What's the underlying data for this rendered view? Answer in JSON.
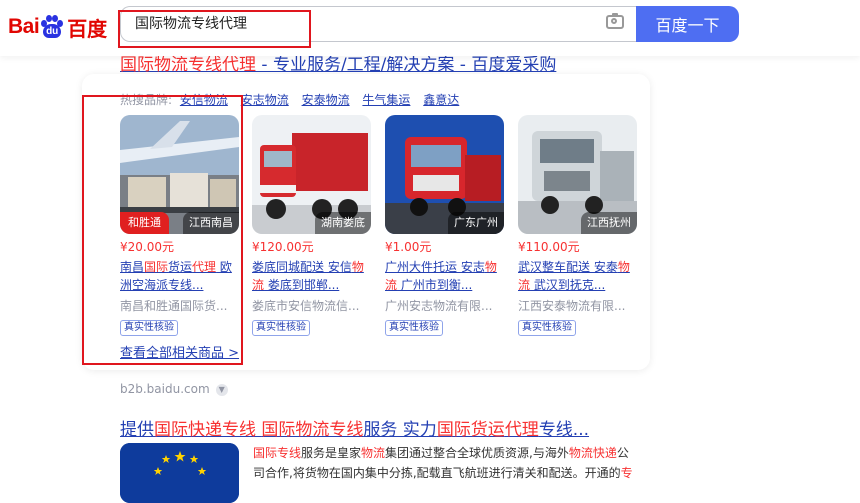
{
  "logo": {
    "part1": "Bai",
    "paw": "du",
    "cn": "百度"
  },
  "search": {
    "value": "国际物流专线代理",
    "button": "百度一下"
  },
  "result1": {
    "title_parts": [
      {
        "t": "国际物流专线代理",
        "em": true
      },
      {
        "t": " - 专业服务/工程/解决方案 - 百度爱采购",
        "em": false
      }
    ]
  },
  "hot_brands": {
    "label": "热搜品牌:",
    "items": [
      "安信物流",
      "安志物流",
      "安泰物流",
      "牛气集运",
      "鑫意达"
    ]
  },
  "products": [
    {
      "location": "江西南昌",
      "tag": "和胜通",
      "price": "¥20.00元",
      "title_parts": [
        {
          "t": "南昌",
          "em": false
        },
        {
          "t": "国际",
          "em": true
        },
        {
          "t": "货运",
          "em": false
        },
        {
          "t": "代理",
          "em": true
        },
        {
          "t": " 欧洲空海派专线...",
          "em": false
        }
      ],
      "seller": "南昌和胜通国际货...",
      "verify": "真实性核验"
    },
    {
      "location": "湖南娄底",
      "tag": "",
      "price": "¥120.00元",
      "title_parts": [
        {
          "t": "娄底同城配送 安信",
          "em": false
        },
        {
          "t": "物流",
          "em": true
        },
        {
          "t": " 娄底到邯郸...",
          "em": false
        }
      ],
      "seller": "娄底市安信物流信...",
      "verify": "真实性核验"
    },
    {
      "location": "广东广州",
      "tag": "",
      "price": "¥1.00元",
      "title_parts": [
        {
          "t": "广州大件托运 安志",
          "em": false
        },
        {
          "t": "物流",
          "em": true
        },
        {
          "t": " 广州市到衡...",
          "em": false
        }
      ],
      "seller": "广州安志物流有限...",
      "verify": "真实性核验"
    },
    {
      "location": "江西抚州",
      "tag": "",
      "price": "¥110.00元",
      "title_parts": [
        {
          "t": "武汉整车配送 安泰",
          "em": false
        },
        {
          "t": "物流",
          "em": true
        },
        {
          "t": " 武汉到抚克...",
          "em": false
        }
      ],
      "seller": "江西安泰物流有限...",
      "verify": "真实性核验"
    }
  ],
  "view_all": "查看全部相关商品 >",
  "source": "b2b.baidu.com",
  "result2": {
    "title_parts": [
      {
        "t": "提供",
        "em": false
      },
      {
        "t": "国际快递专线",
        "em": true
      },
      {
        "t": " ",
        "em": false
      },
      {
        "t": "国际物流专线",
        "em": true
      },
      {
        "t": "服务 实力",
        "em": false
      },
      {
        "t": "国际货运",
        "em": true
      },
      {
        "t": "代理",
        "em": true
      },
      {
        "t": "专线...",
        "em": false
      }
    ],
    "snippet_parts": [
      {
        "t": "国际专线",
        "em": true
      },
      {
        "t": "服务是皇家",
        "em": false
      },
      {
        "t": "物流",
        "em": true
      },
      {
        "t": "集团通过整合全球优质资源,与海外",
        "em": false
      },
      {
        "t": "物流快递",
        "em": true
      },
      {
        "t": "公司合作,将货物在国内集中分拣,配载直飞航班进行清关和配送。开通的",
        "em": false
      },
      {
        "t": "专",
        "em": true
      }
    ]
  },
  "colors": {
    "accent": "#4e6ef2",
    "link": "#2440b3",
    "highlight": "#f73131",
    "annotation": "#e0161e"
  }
}
